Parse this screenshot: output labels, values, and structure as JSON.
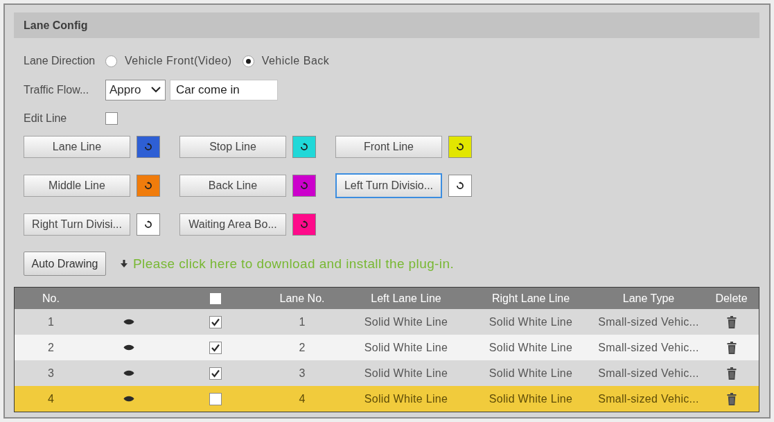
{
  "panel": {
    "title": "Lane Config"
  },
  "lane_direction": {
    "label": "Lane Direction",
    "options": [
      {
        "label": "Vehicle Front(Video)",
        "selected": false
      },
      {
        "label": "Vehicle Back",
        "selected": true
      }
    ]
  },
  "traffic_flow": {
    "label": "Traffic Flow...",
    "select_value": "Appro",
    "input_value": "Car come in"
  },
  "edit_line": {
    "label": "Edit Line",
    "checked": false
  },
  "line_buttons": [
    {
      "label": "Lane Line",
      "color": "#2e5fd4",
      "focused": false
    },
    {
      "label": "Stop Line",
      "color": "#20d8d8",
      "focused": false
    },
    {
      "label": "Front Line",
      "color": "#e2e600",
      "focused": false
    },
    {
      "label": "Middle Line",
      "color": "#f07c0c",
      "focused": false
    },
    {
      "label": "Back Line",
      "color": "#cc00cc",
      "focused": false
    },
    {
      "label": "Left Turn Divisio...",
      "color": "#ffffff",
      "focused": true
    },
    {
      "label": "Right Turn Divisi...",
      "color": "#ffffff",
      "focused": false
    },
    {
      "label": "Waiting Area Bo...",
      "color": "#ff0a8a",
      "focused": false
    }
  ],
  "auto_drawing": {
    "label": "Auto Drawing"
  },
  "plugin_link": {
    "text": "Please click here to download and install the plug-in."
  },
  "table": {
    "columns": [
      {
        "kind": "text",
        "label": "No."
      },
      {
        "kind": "blank"
      },
      {
        "kind": "checkbox",
        "checked": false
      },
      {
        "kind": "text",
        "label": "Lane No."
      },
      {
        "kind": "text",
        "label": "Left Lane Line"
      },
      {
        "kind": "text",
        "label": "Right Lane Line"
      },
      {
        "kind": "text",
        "label": "Lane Type"
      },
      {
        "kind": "text",
        "label": "Delete"
      }
    ],
    "rows": [
      {
        "no": "1",
        "checked": true,
        "lane_no": "1",
        "left_lane_line": "Solid White Line",
        "right_lane_line": "Solid White Line",
        "lane_type": "Small-sized Vehic...",
        "selected": false
      },
      {
        "no": "2",
        "checked": true,
        "lane_no": "2",
        "left_lane_line": "Solid White Line",
        "right_lane_line": "Solid White Line",
        "lane_type": "Small-sized Vehic...",
        "selected": false
      },
      {
        "no": "3",
        "checked": true,
        "lane_no": "3",
        "left_lane_line": "Solid White Line",
        "right_lane_line": "Solid White Line",
        "lane_type": "Small-sized Vehic...",
        "selected": false
      },
      {
        "no": "4",
        "checked": false,
        "lane_no": "4",
        "left_lane_line": "Solid White Line",
        "right_lane_line": "Solid White Line",
        "lane_type": "Small-sized Vehic...",
        "selected": true
      }
    ]
  }
}
